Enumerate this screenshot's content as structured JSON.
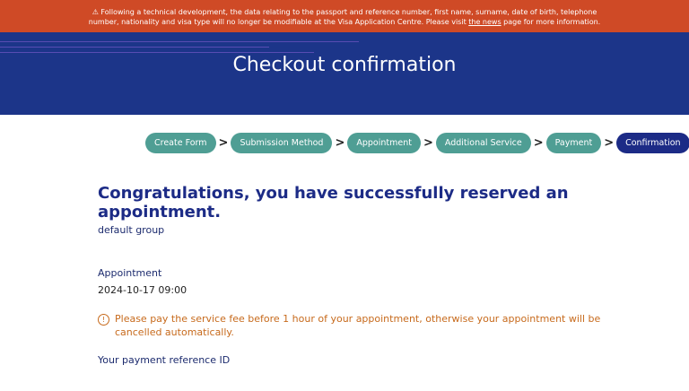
{
  "banner": {
    "line1": "⚠ Following a technical development, the data relating to the passport and reference number, first name, surname, date of birth, telephone",
    "line2_pre": "number, nationality and visa type will no longer be modifiable at the Visa Application Centre. Please visit ",
    "link": "the news",
    "line2_post": " page for more information."
  },
  "hero": {
    "title": "Checkout confirmation"
  },
  "steps": [
    {
      "label": "Create Form"
    },
    {
      "label": "Submission Method"
    },
    {
      "label": "Appointment"
    },
    {
      "label": "Additional Service"
    },
    {
      "label": "Payment"
    },
    {
      "label": "Confirmation"
    }
  ],
  "separator": ">",
  "content": {
    "heading": "Congratulations, you have successfully reserved an appointment.",
    "group": "default group",
    "appointment_label": "Appointment",
    "appointment_value": "2024-10-17 09:00",
    "warning_icon": "!",
    "warning": "Please pay the service fee before 1 hour of your appointment, otherwise your appointment will be cancelled automatically.",
    "reference_label": "Your payment reference ID"
  },
  "colors": {
    "banner": "#cf4a26",
    "hero": "#1c3589",
    "step": "#4f9e94",
    "step_active": "#1c2b86",
    "warning": "#c76a1c"
  }
}
